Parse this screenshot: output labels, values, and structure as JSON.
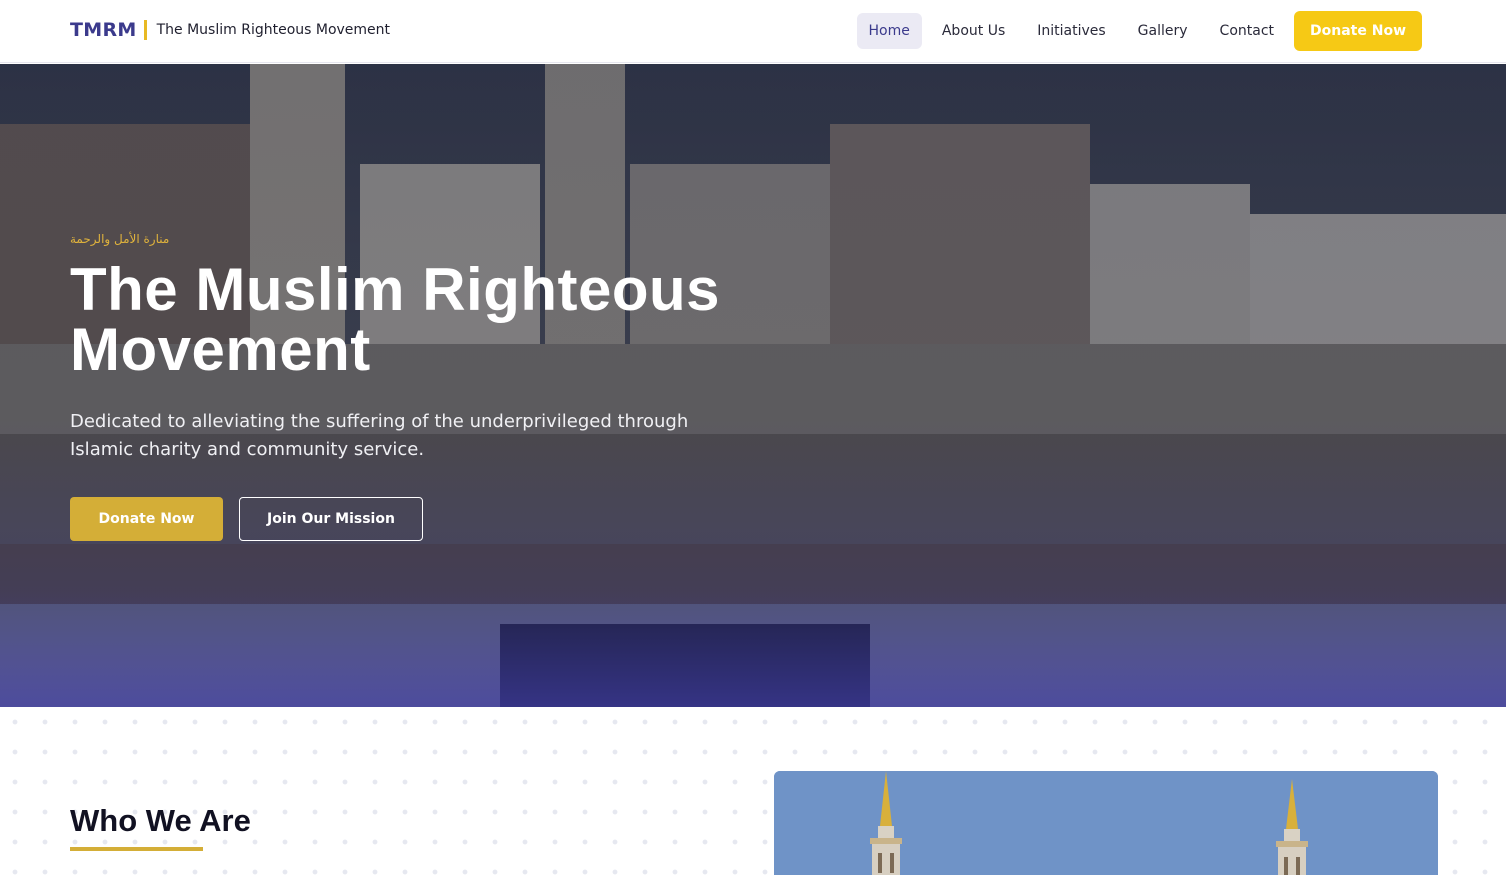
{
  "header": {
    "abbr": "TMRM",
    "name": "The Muslim Righteous Movement",
    "nav": [
      {
        "label": "Home",
        "active": true
      },
      {
        "label": "About Us",
        "active": false
      },
      {
        "label": "Initiatives",
        "active": false
      },
      {
        "label": "Gallery",
        "active": false
      },
      {
        "label": "Contact",
        "active": false
      }
    ],
    "donate_label": "Donate Now"
  },
  "hero": {
    "arabic_tagline": "منارة الأمل والرحمة",
    "title_line1": "The Muslim Righteous",
    "title_line2": "Movement",
    "subtitle": "Dedicated to alleviating the suffering of the underprivileged through Islamic charity and community service.",
    "primary_button": "Donate Now",
    "secondary_button": "Join Our Mission"
  },
  "about": {
    "title": "Who We Are"
  },
  "colors": {
    "brand": "#3b3a8c",
    "gold": "#d4ae37",
    "nav_donate": "#f6c915"
  }
}
